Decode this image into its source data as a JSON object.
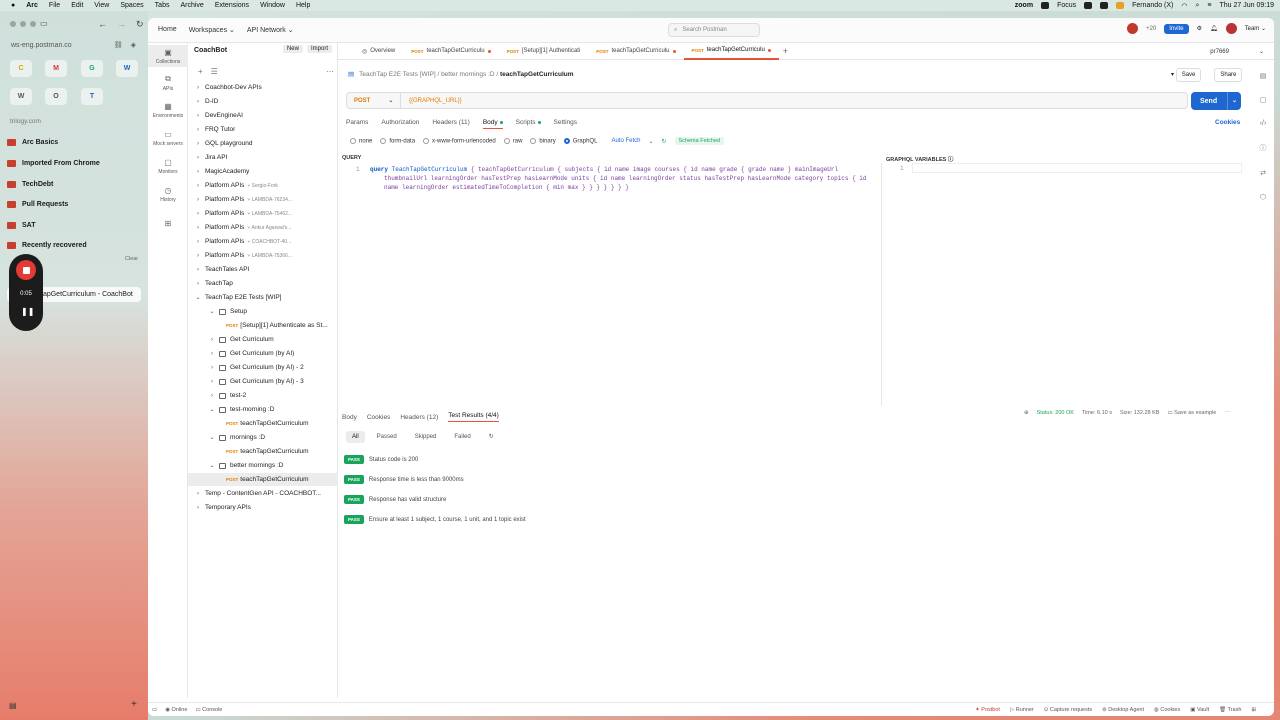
{
  "menubar": {
    "apple": "",
    "app": "Arc",
    "items": [
      "File",
      "Edit",
      "View",
      "Spaces",
      "Tabs",
      "Archive",
      "Extensions",
      "Window",
      "Help"
    ],
    "zoom": "zoom",
    "focus": "Focus",
    "user": "Fernando (X)",
    "datetime": "Thu 27 Jun  09:19"
  },
  "arc": {
    "url": "ws-eng.postman.co",
    "favorites": [
      "M",
      "G",
      "T",
      "W",
      "O",
      "C"
    ],
    "section_host": "trilogy.com",
    "items": [
      "Arc Basics",
      "Imported From Chrome",
      "TechDebt",
      "Pull Requests",
      "SAT",
      "Recently recovered"
    ],
    "clear": "Clear",
    "active_tab": "tapGetCurriculum - CoachBot",
    "recorder_time": "0:05",
    "partial_item": "er"
  },
  "top": {
    "nav": [
      "Home",
      "Workspaces",
      "API Network"
    ],
    "search_placeholder": "Search Postman",
    "count": "+20",
    "invite": "Invite",
    "team": "Team"
  },
  "rail": [
    {
      "label": "Collections",
      "icon": "collections-icon"
    },
    {
      "label": "APIs",
      "icon": "apis-icon"
    },
    {
      "label": "Environments",
      "icon": "env-icon"
    },
    {
      "label": "Mock servers",
      "icon": "mock-icon"
    },
    {
      "label": "Monitors",
      "icon": "monitor-icon"
    },
    {
      "label": "History",
      "icon": "history-icon"
    }
  ],
  "tree": {
    "workspace": "CoachBot",
    "new": "New",
    "import": "Import",
    "rows": [
      {
        "t": "Coachbot-Dev APIs",
        "lvl": 0,
        "k": "c"
      },
      {
        "t": "D-ID",
        "lvl": 0,
        "k": "c"
      },
      {
        "t": "DevEngineAI",
        "lvl": 0,
        "k": "c"
      },
      {
        "t": "FRQ Tutor",
        "lvl": 0,
        "k": "c"
      },
      {
        "t": "GQL playground",
        "lvl": 0,
        "k": "c"
      },
      {
        "t": "Jira API",
        "lvl": 0,
        "k": "c"
      },
      {
        "t": "MagicAcademy",
        "lvl": 0,
        "k": "c"
      },
      {
        "t": "Platform APIs",
        "lvl": 0,
        "k": "c",
        "env": "Sergio-Fork"
      },
      {
        "t": "Platform APIs",
        "lvl": 0,
        "k": "c",
        "env": "LAMBDA-76234..."
      },
      {
        "t": "Platform APIs",
        "lvl": 0,
        "k": "c",
        "env": "LAMBDA-75462..."
      },
      {
        "t": "Platform APIs",
        "lvl": 0,
        "k": "c",
        "env": "Ankur Agarwal's..."
      },
      {
        "t": "Platform APIs",
        "lvl": 0,
        "k": "c",
        "env": "COACHBOT-40..."
      },
      {
        "t": "Platform APIs",
        "lvl": 0,
        "k": "c",
        "env": "LAMBDA-75366..."
      },
      {
        "t": "TeachTales API",
        "lvl": 0,
        "k": "c"
      },
      {
        "t": "TeachTap",
        "lvl": 0,
        "k": "c"
      },
      {
        "t": "TeachTap E2E Tests [WIP]",
        "lvl": 0,
        "k": "o"
      },
      {
        "t": "Setup",
        "lvl": 1,
        "k": "fo"
      },
      {
        "t": "[Setup][1] Authenticate as St...",
        "lvl": 2,
        "k": "r"
      },
      {
        "t": "Get Curriculum",
        "lvl": 1,
        "k": "f"
      },
      {
        "t": "Get Curriculum (by AI)",
        "lvl": 1,
        "k": "f"
      },
      {
        "t": "Get Curriculum (by AI) - 2",
        "lvl": 1,
        "k": "f"
      },
      {
        "t": "Get Curriculum (by AI) - 3",
        "lvl": 1,
        "k": "f"
      },
      {
        "t": "test-2",
        "lvl": 1,
        "k": "f"
      },
      {
        "t": "test-morning :D",
        "lvl": 1,
        "k": "fo"
      },
      {
        "t": "teachTapGetCurriculum",
        "lvl": 2,
        "k": "r"
      },
      {
        "t": "mornings :D",
        "lvl": 1,
        "k": "fo"
      },
      {
        "t": "teachTapGetCurriculum",
        "lvl": 2,
        "k": "r"
      },
      {
        "t": "better mornings :D",
        "lvl": 1,
        "k": "fo"
      },
      {
        "t": "teachTapGetCurriculum",
        "lvl": 2,
        "k": "r",
        "sel": true
      },
      {
        "t": "Temp - ContentGen API - COACHBOT...",
        "lvl": 0,
        "k": "c"
      },
      {
        "t": "Temporary APIs",
        "lvl": 0,
        "k": "c"
      }
    ]
  },
  "tabs": [
    {
      "label": "Overview",
      "method": ""
    },
    {
      "label": "teachTapGetCurriculu",
      "method": "POST",
      "dot": true
    },
    {
      "label": "[Setup][1] Authenticati",
      "method": "POST"
    },
    {
      "label": "teachTapGetCurriculu",
      "method": "POST",
      "dot": true
    },
    {
      "label": "teachTapGetCurriculu",
      "method": "POST",
      "dot": true,
      "active": true
    }
  ],
  "env": "pr7669",
  "crumbs": {
    "a": "TeachTap E2E Tests [WIP]",
    "b": "better mornings :D",
    "c": "teachTapGetCurriculum"
  },
  "save": "Save",
  "share": "Share",
  "request": {
    "method": "POST",
    "url": "{{GRAPHQL_URL}}",
    "send": "Send"
  },
  "reqtabs": {
    "params": "Params",
    "auth": "Authorization",
    "headers": "Headers (11)",
    "body": "Body",
    "scripts": "Scripts",
    "settings": "Settings",
    "cookies": "Cookies"
  },
  "bodytypes": {
    "none": "none",
    "form": "form-data",
    "urlenc": "x-www-form-urlencoded",
    "raw": "raw",
    "binary": "binary",
    "graphql": "GraphQL",
    "auto": "Auto Fetch",
    "schema": "Schema Fetched"
  },
  "editor": {
    "query_label": "QUERY",
    "vars_label": "GRAPHQL VARIABLES",
    "line": "1",
    "kw": "query",
    "opname": "TeachTapGetCurriculum",
    "l1": " { teachTapGetCurriculum { subjects { id name image courses { id name grade { grade name } mainImageUrl",
    "l2": "thumbnailUrl learningOrder hasTestPrep hasLearnMode units { id name learningOrder status hasTestPrep hasLearnMode category topics { id",
    "l3": "name learningOrder estimatedTimeToCompletion { min max } } } } } } }"
  },
  "response": {
    "tabs": [
      "Body",
      "Cookies",
      "Headers (12)",
      "Test Results (4/4)"
    ],
    "status": "Status: 200 OK",
    "time": "Time: 6.10 s",
    "size": "Size: 132.28 KB",
    "save": "Save as example",
    "filters": [
      "All",
      "Passed",
      "Skipped",
      "Failed"
    ],
    "tests": [
      {
        "badge": "PASS",
        "text": "Status code is 200"
      },
      {
        "badge": "PASS",
        "text": "Response time is less than 9000ms"
      },
      {
        "badge": "PASS",
        "text": "Response has valid structure"
      },
      {
        "badge": "PASS",
        "text": "Ensure at least 1 subject, 1 course, 1 unit, and 1 topic exist"
      }
    ]
  },
  "status": {
    "online": "Online",
    "console": "Console",
    "postbot": "Postbot",
    "runner": "Runner",
    "capture": "Capture requests",
    "agent": "Desktop Agent",
    "cookies": "Cookies",
    "vault": "Vault",
    "trash": "Trash"
  }
}
